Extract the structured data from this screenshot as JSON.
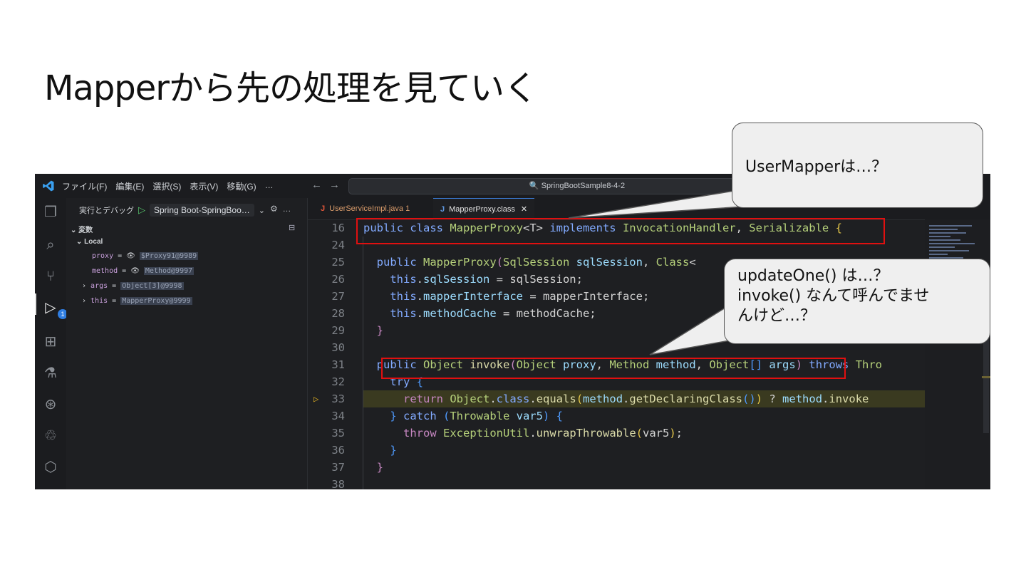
{
  "slide": {
    "title": "Mapperから先の処理を見ていく"
  },
  "titlebar": {
    "menu": [
      "ファイル(F)",
      "編集(E)",
      "選択(S)",
      "表示(V)",
      "移動(G)",
      "…"
    ],
    "search_label": "🔍 SpringBootSample8-4-2"
  },
  "sidebar": {
    "run_debug_label": "実行とデバッグ",
    "config_label": "Spring Boot-SpringBoo…",
    "variables_title": "変数",
    "local_label": "Local",
    "variables": [
      {
        "name": "proxy",
        "value": "$Proxy91@9989",
        "expandable": false,
        "watch": true
      },
      {
        "name": "method",
        "value": "Method@9997",
        "expandable": false,
        "watch": true
      },
      {
        "name": "args",
        "value": "Object[3]@9998",
        "expandable": true,
        "watch": false
      },
      {
        "name": "this",
        "value": "MapperProxy@9999",
        "expandable": true,
        "watch": false
      }
    ]
  },
  "editor": {
    "tabs": [
      {
        "label": "UserServiceImpl.java 1",
        "active": false
      },
      {
        "label": "MapperProxy.class",
        "active": true
      }
    ],
    "line_numbers": [
      "16",
      "24",
      "25",
      "26",
      "27",
      "28",
      "29",
      "30",
      "31",
      "32",
      "33",
      "34",
      "35",
      "36",
      "37",
      "38"
    ],
    "current_line": "33"
  },
  "callouts": [
    {
      "text": "UserMapperは…？"
    },
    {
      "text": "updateOne() は…？\ninvoke() なんて呼んでませ\nんけど…？"
    }
  ],
  "colors": {
    "highlight_box": "#e01010",
    "bubble_fill": "#efefef"
  }
}
